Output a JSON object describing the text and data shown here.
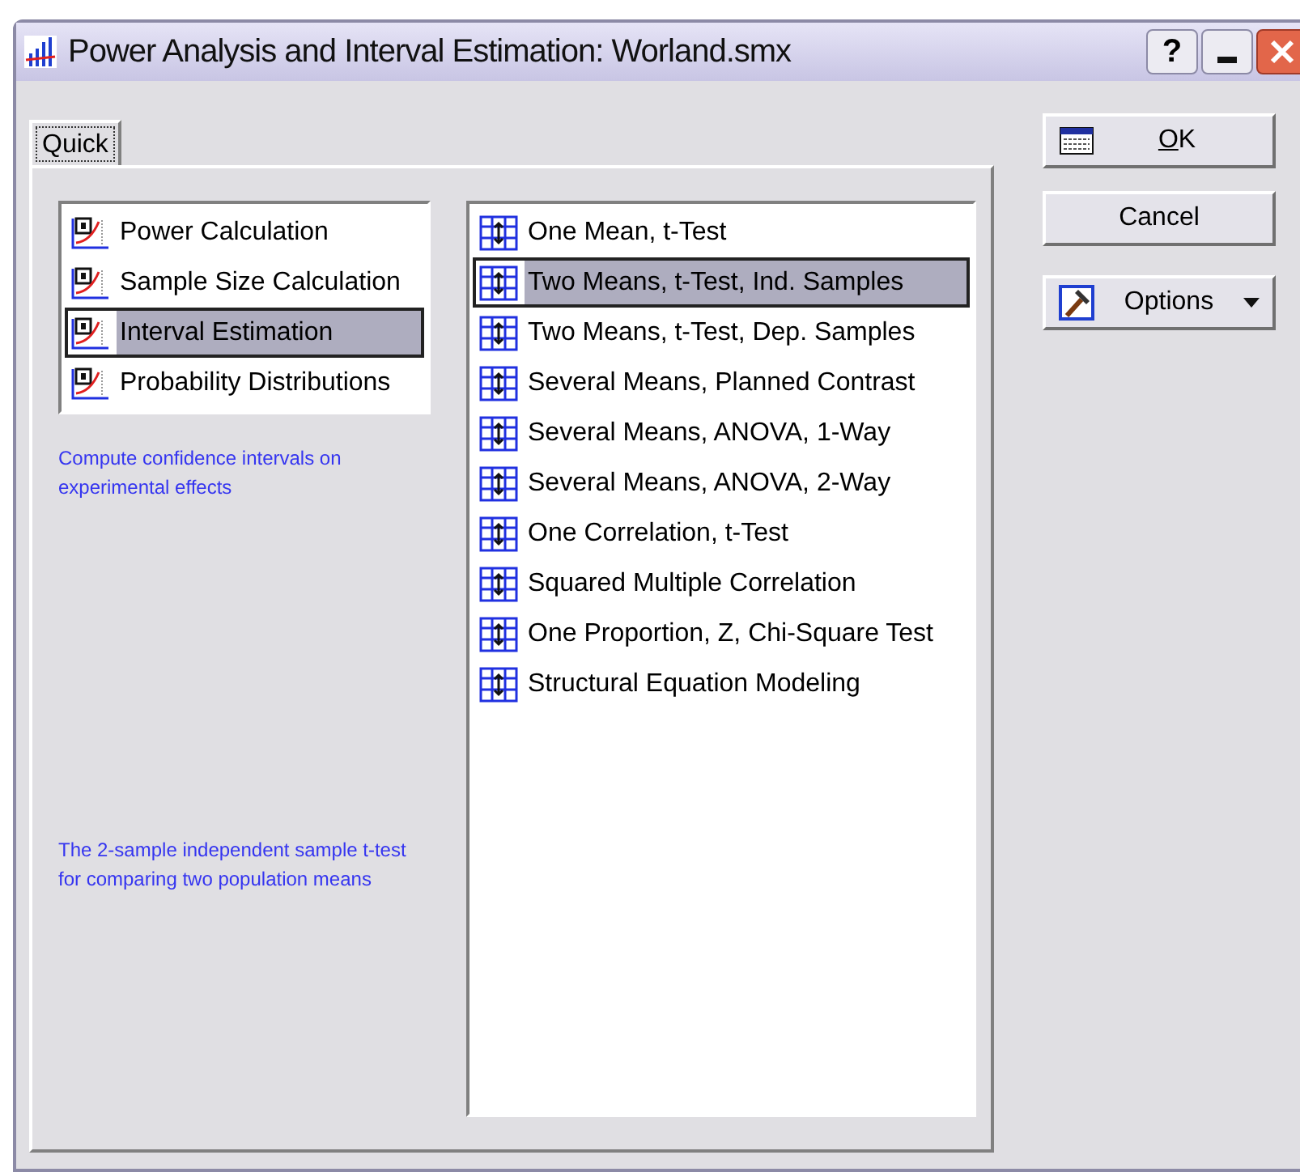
{
  "window": {
    "title": "Power Analysis and Interval Estimation: Worland.smx",
    "help": "?"
  },
  "tabs": [
    {
      "label": "Quick",
      "selected": true
    }
  ],
  "analysis_types": [
    {
      "label": "Power Calculation",
      "selected": false
    },
    {
      "label": "Sample Size Calculation",
      "selected": false
    },
    {
      "label": "Interval Estimation",
      "selected": true
    },
    {
      "label": "Probability Distributions",
      "selected": false
    }
  ],
  "analysis_description": "Compute confidence intervals on experimental effects",
  "tests": [
    {
      "label": "One Mean, t-Test",
      "selected": false
    },
    {
      "label": "Two Means, t-Test, Ind. Samples",
      "selected": true
    },
    {
      "label": "Two Means, t-Test, Dep. Samples",
      "selected": false
    },
    {
      "label": "Several Means, Planned Contrast",
      "selected": false
    },
    {
      "label": "Several Means, ANOVA, 1-Way",
      "selected": false
    },
    {
      "label": "Several Means, ANOVA, 2-Way",
      "selected": false
    },
    {
      "label": "One Correlation, t-Test",
      "selected": false
    },
    {
      "label": "Squared Multiple Correlation",
      "selected": false
    },
    {
      "label": "One Proportion, Z, Chi-Square Test",
      "selected": false
    },
    {
      "label": "Structural Equation Modeling",
      "selected": false
    }
  ],
  "test_description": "The 2-sample independent sample t-test for comparing two population means",
  "buttons": [
    {
      "kind": "ok",
      "label": "OK"
    },
    {
      "kind": "cancel",
      "label": "Cancel"
    },
    {
      "kind": "options",
      "label": "Options"
    }
  ]
}
